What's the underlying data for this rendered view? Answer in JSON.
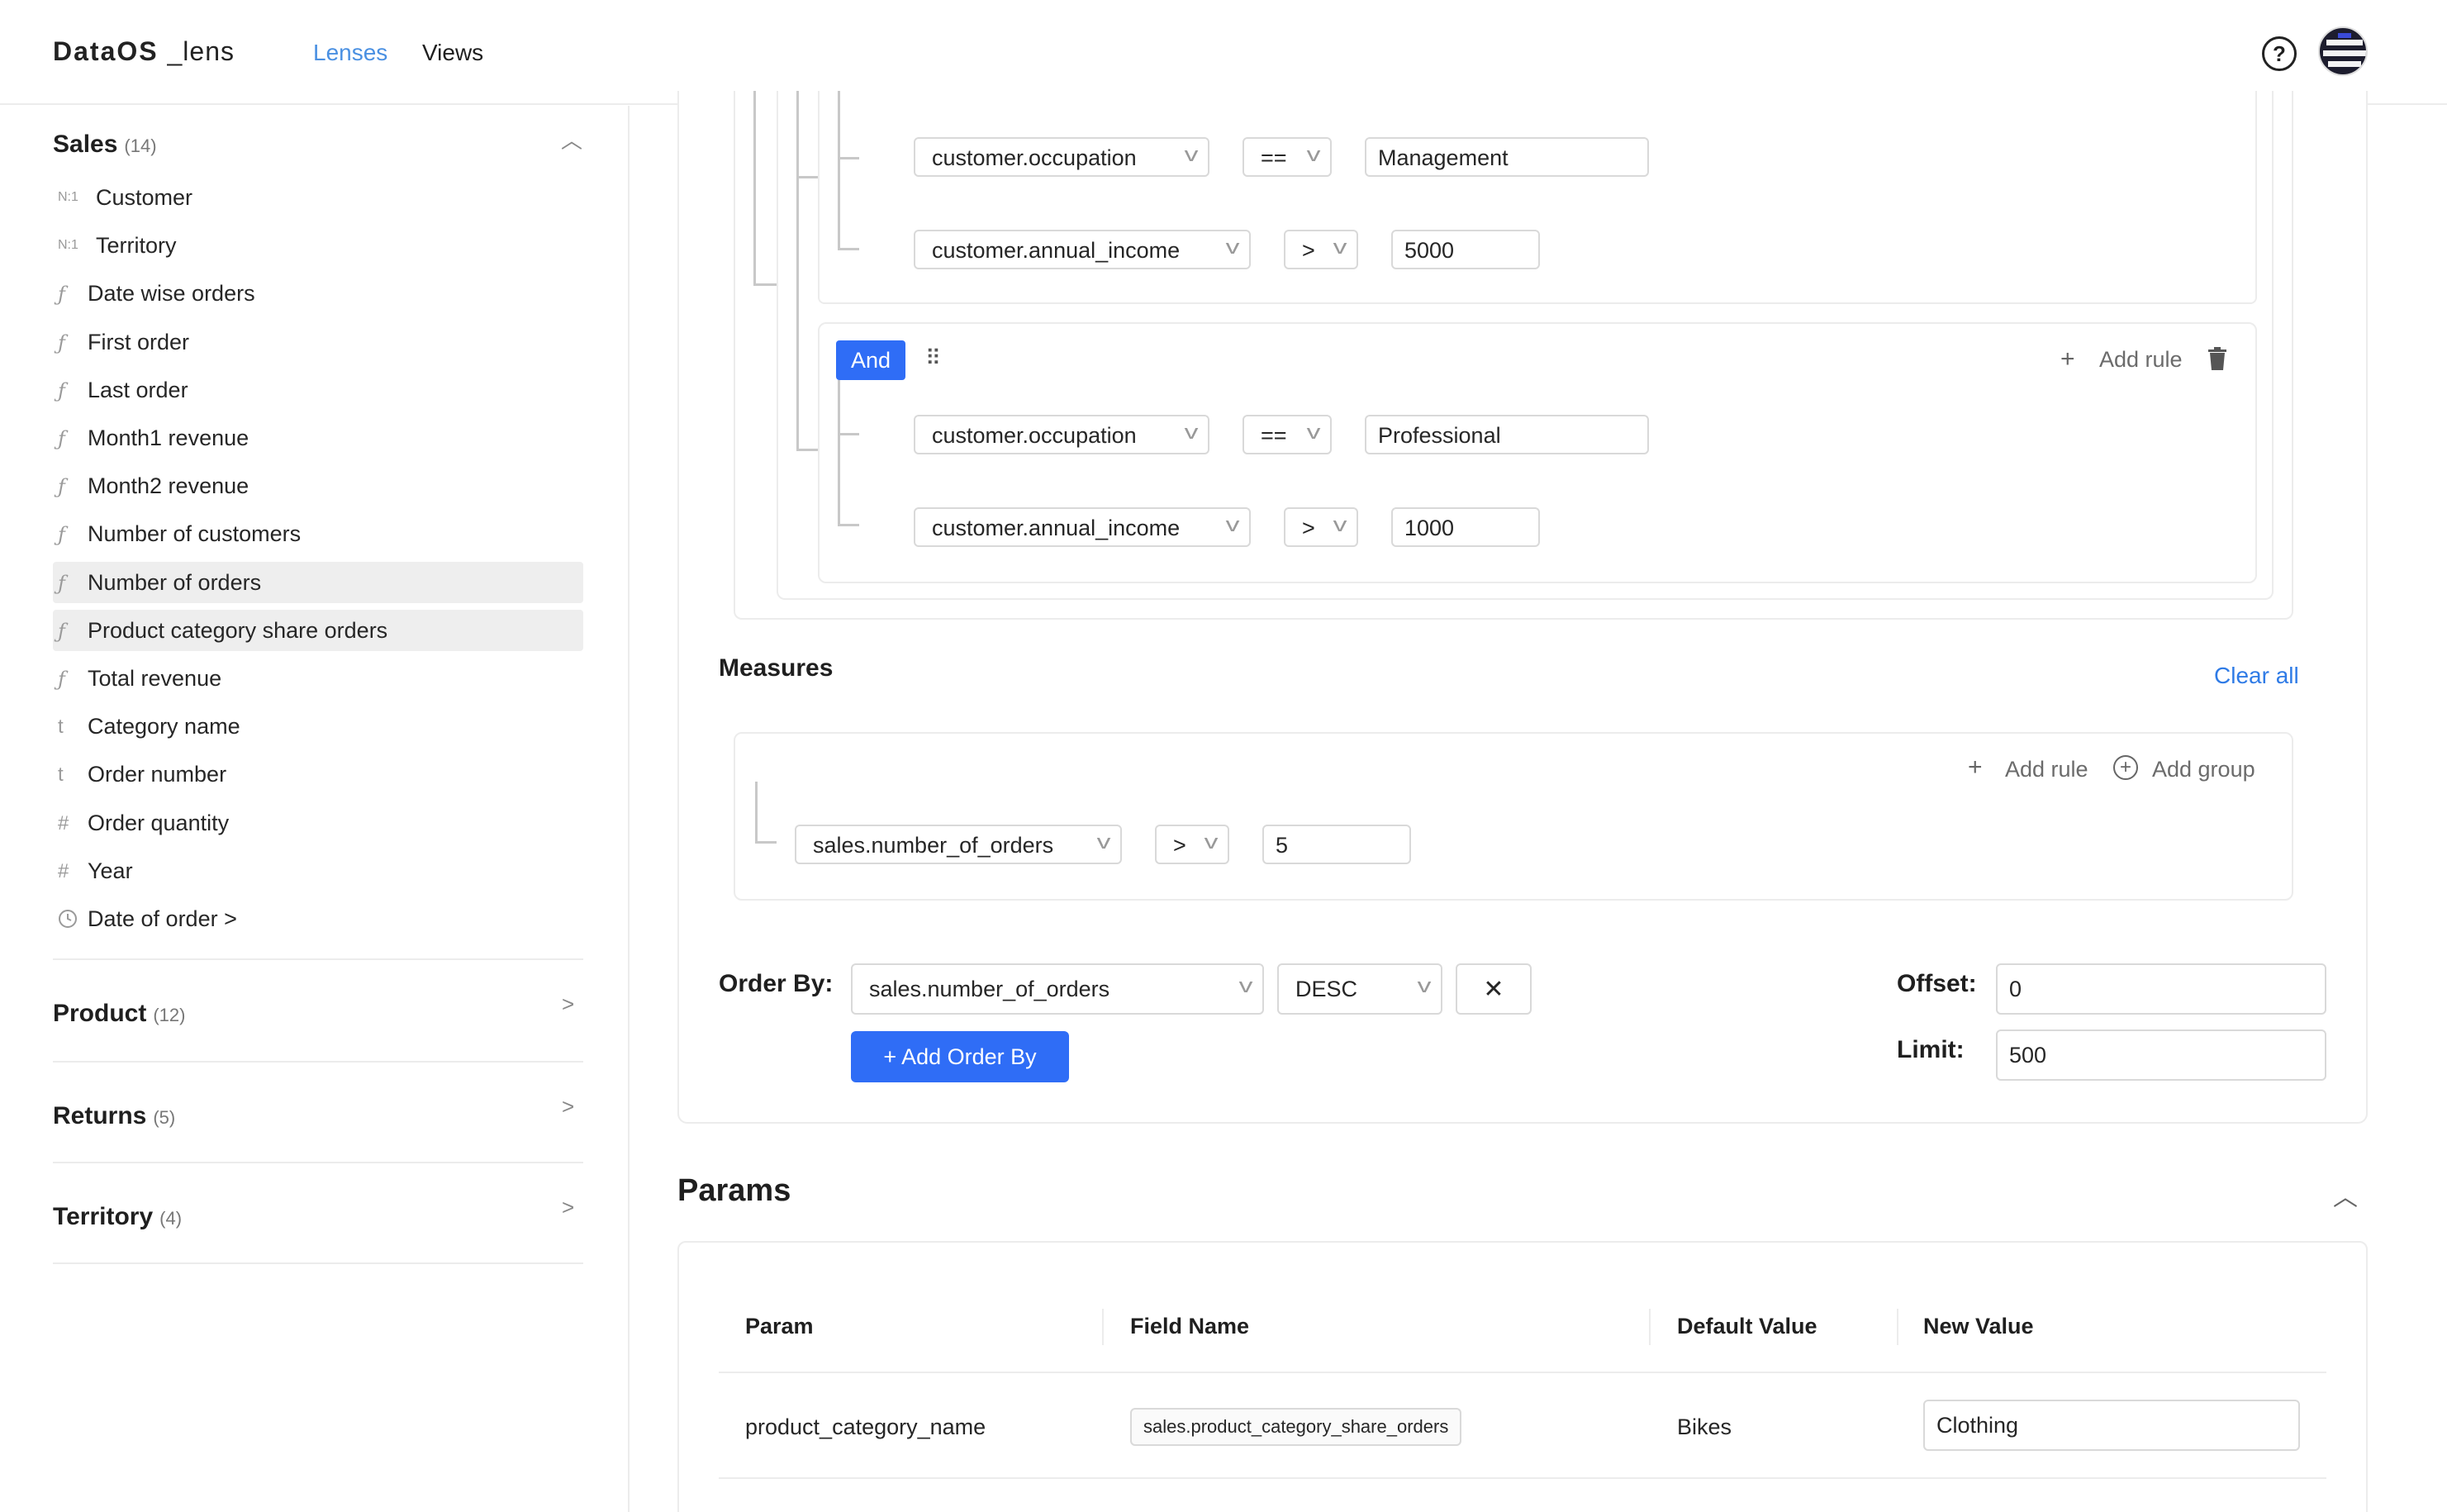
{
  "header": {
    "logo_main": "DataOS",
    "logo_suffix": "_lens",
    "nav": {
      "lenses": "Lenses",
      "views": "Views"
    },
    "help_symbol": "?"
  },
  "sidebar": {
    "sales": {
      "title": "Sales",
      "count": "(14)",
      "items": [
        {
          "icon": "N:1",
          "label": "Customer"
        },
        {
          "icon": "N:1",
          "label": "Territory"
        },
        {
          "icon": "ƒ",
          "label": "Date wise orders"
        },
        {
          "icon": "ƒ",
          "label": "First order"
        },
        {
          "icon": "ƒ",
          "label": "Last order"
        },
        {
          "icon": "ƒ",
          "label": "Month1 revenue"
        },
        {
          "icon": "ƒ",
          "label": "Month2 revenue"
        },
        {
          "icon": "ƒ",
          "label": "Number of customers"
        },
        {
          "icon": "ƒ",
          "label": "Number of orders"
        },
        {
          "icon": "ƒ",
          "label": "Product category share orders"
        },
        {
          "icon": "ƒ",
          "label": "Total revenue"
        },
        {
          "icon": "t",
          "label": "Category name"
        },
        {
          "icon": "t",
          "label": "Order number"
        },
        {
          "icon": "#",
          "label": "Order quantity"
        },
        {
          "icon": "#",
          "label": "Year"
        },
        {
          "icon": "clock-icon",
          "label": "Date of order >"
        }
      ]
    },
    "product": {
      "title": "Product",
      "count": "(12)"
    },
    "returns": {
      "title": "Returns",
      "count": "(5)"
    },
    "territory": {
      "title": "Territory",
      "count": "(4)"
    }
  },
  "filters": {
    "group1": {
      "rules": [
        {
          "field": "customer.occupation",
          "op": "==",
          "value": "Management"
        },
        {
          "field": "customer.annual_income",
          "op": ">",
          "value": "5000"
        }
      ]
    },
    "group2": {
      "combinator": "And",
      "add_rule": "Add rule",
      "rules": [
        {
          "field": "customer.occupation",
          "op": "==",
          "value": "Professional"
        },
        {
          "field": "customer.annual_income",
          "op": ">",
          "value": "1000"
        }
      ]
    }
  },
  "measures": {
    "title": "Measures",
    "clear_all": "Clear all",
    "add_rule": "Add rule",
    "add_group": "Add group",
    "rule": {
      "field": "sales.number_of_orders",
      "op": ">",
      "value": "5"
    }
  },
  "order_by": {
    "label": "Order By:",
    "field": "sales.number_of_orders",
    "direction": "DESC",
    "remove": "✕",
    "add_button": "+ Add Order By",
    "offset_label": "Offset:",
    "offset_value": "0",
    "limit_label": "Limit:",
    "limit_value": "500"
  },
  "params": {
    "title": "Params",
    "columns": [
      "Param",
      "Field Name",
      "Default Value",
      "New Value"
    ],
    "rows": [
      {
        "param": "product_category_name",
        "field_name": "sales.product_category_share_orders",
        "default_value": "Bikes",
        "new_value": "Clothing"
      }
    ]
  },
  "colors": {
    "accent": "#2f6df6",
    "link": "#2f7be6",
    "nav_active": "#4a90e2"
  }
}
